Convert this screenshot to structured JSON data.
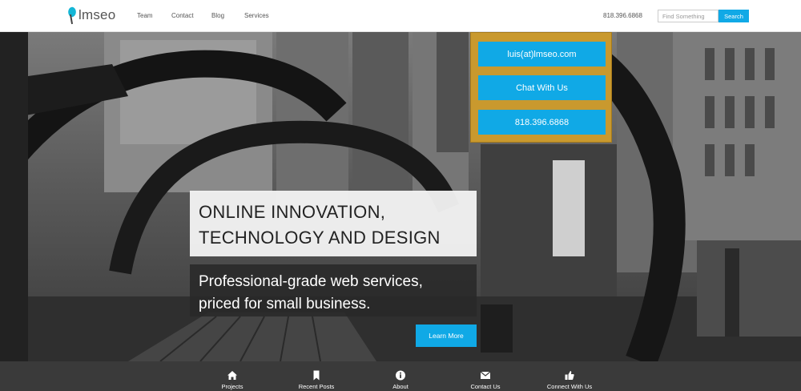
{
  "header": {
    "logo_text": "lmseo",
    "nav": [
      {
        "label": "Team"
      },
      {
        "label": "Contact"
      },
      {
        "label": "Blog"
      },
      {
        "label": "Services"
      }
    ],
    "phone": "818.396.6868",
    "search": {
      "placeholder": "Find Something",
      "value": "",
      "button_label": "Search"
    }
  },
  "contact_panel": {
    "email": "luis(at)lmseo.com",
    "chat": "Chat With Us",
    "phone": "818.396.6868"
  },
  "hero": {
    "headline": "ONLINE INNOVATION,\nTECHNOLOGY AND DESIGN",
    "subheadline": "Professional-grade web services,\npriced for small business.",
    "cta_label": "Learn More"
  },
  "footer": {
    "items": [
      {
        "label": "Projects",
        "icon": "home-icon"
      },
      {
        "label": "Recent Posts",
        "icon": "bookmark-icon"
      },
      {
        "label": "About",
        "icon": "info-icon"
      },
      {
        "label": "Contact Us",
        "icon": "envelope-icon"
      },
      {
        "label": "Connect With Us",
        "icon": "thumbs-up-icon"
      }
    ]
  },
  "colors": {
    "accent": "#10a9e6",
    "panel_gold": "#c9992e",
    "footer_bg": "#3a3a3a",
    "logo_drop": "#14b6d6"
  }
}
